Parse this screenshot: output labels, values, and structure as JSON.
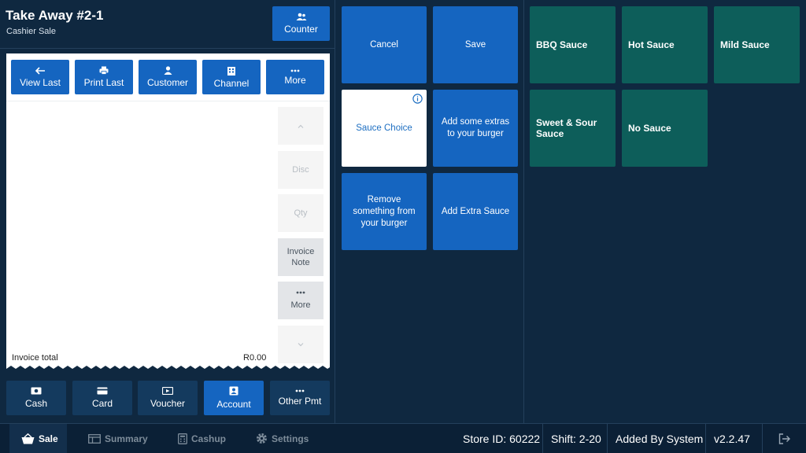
{
  "header": {
    "title": "Take Away #2-1",
    "subtitle": "Cashier Sale",
    "counter_label": "Counter"
  },
  "toolbar": {
    "view_last": "View Last",
    "print_last": "Print Last",
    "customer": "Customer",
    "channel": "Channel",
    "more": "More"
  },
  "side": {
    "disc": "Disc",
    "qty": "Qty",
    "invoice_note_1": "Invoice",
    "invoice_note_2": "Note",
    "more": "More"
  },
  "invoice": {
    "total_label": "Invoice total",
    "total_value": "R0.00"
  },
  "payments": {
    "cash": "Cash",
    "card": "Card",
    "voucher": "Voucher",
    "account": "Account",
    "other": "Other Pmt"
  },
  "actions": {
    "cancel": "Cancel",
    "save": "Save",
    "sauce_choice": "Sauce Choice",
    "add_extras": "Add some extras to your burger",
    "remove": "Remove something from your burger",
    "add_extra_sauce": "Add Extra Sauce"
  },
  "sauces": [
    "BBQ Sauce",
    "Hot Sauce",
    "Mild Sauce",
    "Sweet & Sour Sauce",
    "No Sauce"
  ],
  "nav": {
    "sale": "Sale",
    "summary": "Summary",
    "cashup": "Cashup",
    "settings": "Settings"
  },
  "status": {
    "store": "Store ID: 60222",
    "shift": "Shift: 2-20",
    "added_by": "Added By System",
    "version": "v2.2.47"
  },
  "colors": {
    "accent": "#1565c0",
    "sauce_tile": "#0d5e5a",
    "background": "#0f2840"
  }
}
